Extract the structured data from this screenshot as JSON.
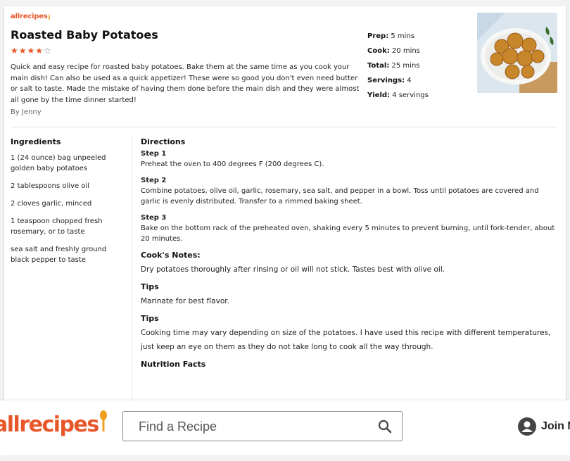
{
  "recipe": {
    "brand": "allrecipes",
    "title": "Roasted Baby Potatoes",
    "rating": 4,
    "rating_max": 5,
    "description": "Quick and easy recipe for roasted baby potatoes. Bake them at the same time as you cook your main dish! Can also be used as a quick appetizer! These were so good you don't even need butter or salt to taste. Made the mistake of having them done before the main dish and they were almost all gone by the time dinner started!",
    "byline": "By Jenny",
    "meta": [
      {
        "label": "Prep:",
        "value": "5 mins"
      },
      {
        "label": "Cook:",
        "value": "20 mins"
      },
      {
        "label": "Total:",
        "value": "25 mins"
      },
      {
        "label": "Servings:",
        "value": "4"
      },
      {
        "label": "Yield:",
        "value": "4 servings"
      }
    ],
    "ingredients_heading": "Ingredients",
    "ingredients": [
      "1 (24 ounce) bag unpeeled golden baby potatoes",
      "2 tablespoons olive oil",
      "2 cloves garlic, minced",
      "1 teaspoon chopped fresh rosemary, or to taste",
      "sea salt and freshly ground black pepper to taste"
    ],
    "directions_heading": "Directions",
    "steps": [
      {
        "label": "Step 1",
        "text": "Preheat the oven to 400 degrees F (200 degrees C)."
      },
      {
        "label": "Step 2",
        "text": "Combine potatoes, olive oil, garlic, rosemary, sea salt, and pepper in a bowl. Toss until potatoes are covered and garlic is evenly distributed. Transfer to a rimmed baking sheet."
      },
      {
        "label": "Step 3",
        "text": "Bake on the bottom rack of the preheated oven, shaking every 5 minutes to prevent burning, until fork-tender, about 20 minutes."
      }
    ],
    "notes": [
      {
        "heading": "Cook's Notes:",
        "text": "Dry potatoes thoroughly after rinsing or oil will not stick. Tastes best with olive oil."
      },
      {
        "heading": "Tips",
        "text": "Marinate for best flavor."
      },
      {
        "heading": "Tips",
        "text": "Cooking time may vary depending on size of the potatoes. I have used this recipe with different temperatures, just keep an eye on them as they do not take long to cook all the way through."
      }
    ],
    "nutrition_heading": "Nutrition Facts"
  },
  "header": {
    "logo_text": "allrecipes",
    "search_placeholder": "Find a Recipe",
    "join_label": "Join N"
  },
  "colors": {
    "brand": "#e8572a",
    "spoon": "#f0a020"
  }
}
